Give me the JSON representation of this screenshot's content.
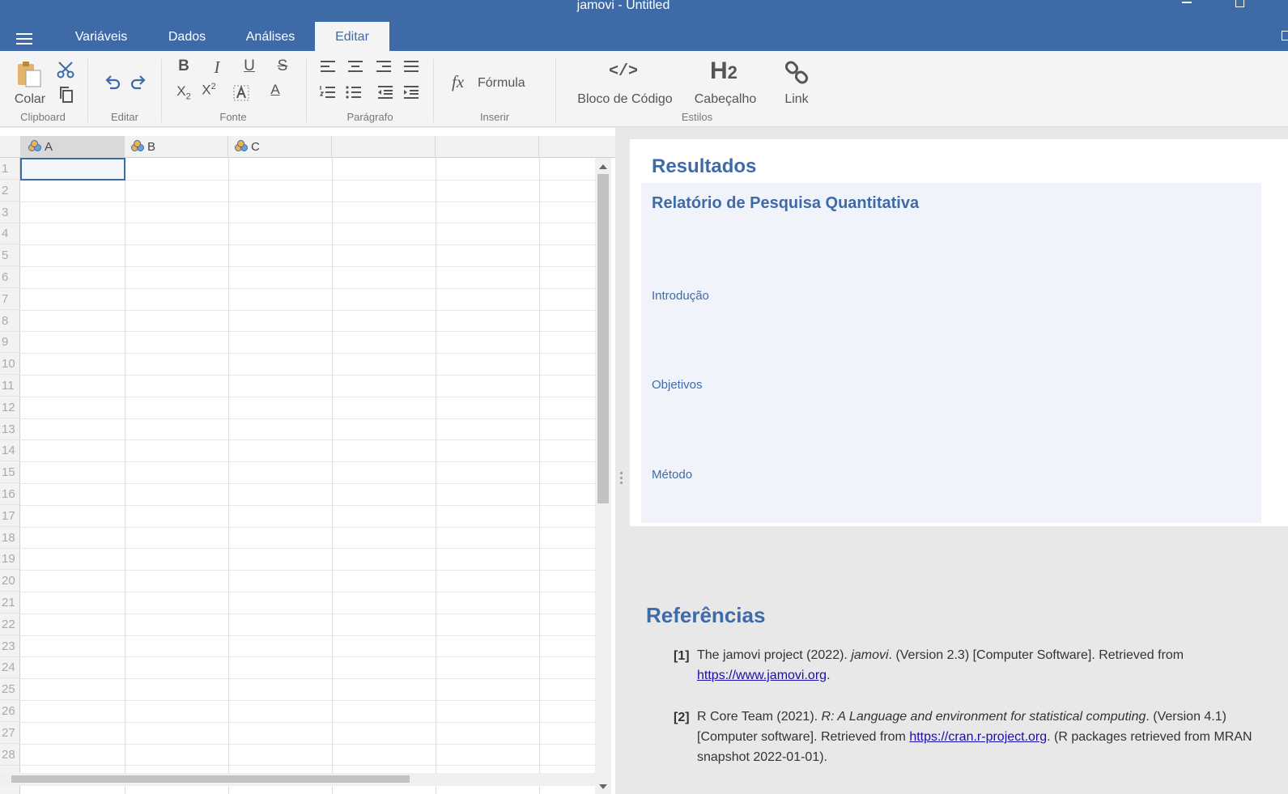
{
  "window": {
    "title": "jamovi - Untitled"
  },
  "tabs": [
    {
      "label": "Variáveis"
    },
    {
      "label": "Dados"
    },
    {
      "label": "Análises"
    },
    {
      "label": "Editar",
      "active": true
    }
  ],
  "ribbon": {
    "clipboard": {
      "group_label": "Clipboard",
      "paste_label": "Colar"
    },
    "edit": {
      "group_label": "Editar"
    },
    "font": {
      "group_label": "Fonte",
      "bold": "B",
      "italic": "I",
      "underline": "U",
      "strike": "S",
      "subscript_base": "X",
      "subscript_sub": "2",
      "superscript_base": "X",
      "superscript_sup": "2",
      "font_color": "A"
    },
    "paragraph": {
      "group_label": "Parágrafo"
    },
    "insert": {
      "group_label": "Inserir",
      "formula_label": "Fórmula",
      "formula_glyph": "fx"
    },
    "styles": {
      "group_label": "Estilos",
      "code_block_label": "Bloco de Código",
      "code_glyph": "</>",
      "heading_label": "Cabeçalho",
      "heading_glyph": "H",
      "heading_sub": "2",
      "link_label": "Link"
    }
  },
  "spreadsheet": {
    "columns": [
      {
        "name": "A"
      },
      {
        "name": "B"
      },
      {
        "name": "C"
      }
    ],
    "rows": [
      "1",
      "2",
      "3",
      "4",
      "5",
      "6",
      "7",
      "8",
      "9",
      "10",
      "11",
      "12",
      "13",
      "14",
      "15",
      "16",
      "17",
      "18",
      "19",
      "20",
      "21",
      "22",
      "23",
      "24",
      "25",
      "26",
      "27",
      "28"
    ],
    "selected_cell": "A1"
  },
  "results": {
    "title": "Resultados",
    "subtitle": "Relatório de Pesquisa Quantitativa",
    "sections": [
      "Introdução",
      "Objetivos",
      "Método"
    ],
    "references_title": "Referências",
    "references": [
      {
        "num": "[1]",
        "pre": "The jamovi project (2022). ",
        "italic": "jamovi",
        "post": ". (Version 2.3) [Computer Software]. Retrieved from ",
        "link": "https://www.jamovi.org",
        "tail": "."
      },
      {
        "num": "[2]",
        "pre": "R Core Team (2021). ",
        "italic": "R: A Language and environment for statistical computing",
        "post": ". (Version 4.1) [Computer software]. Retrieved from ",
        "link": "https://cran.r-project.org",
        "tail": ". (R packages retrieved from MRAN snapshot 2022-01-01)."
      }
    ]
  },
  "colors": {
    "brand": "#3e6ba8",
    "ribbon_bg": "#f4f4f4",
    "results_panel": "#f0f4fa"
  }
}
